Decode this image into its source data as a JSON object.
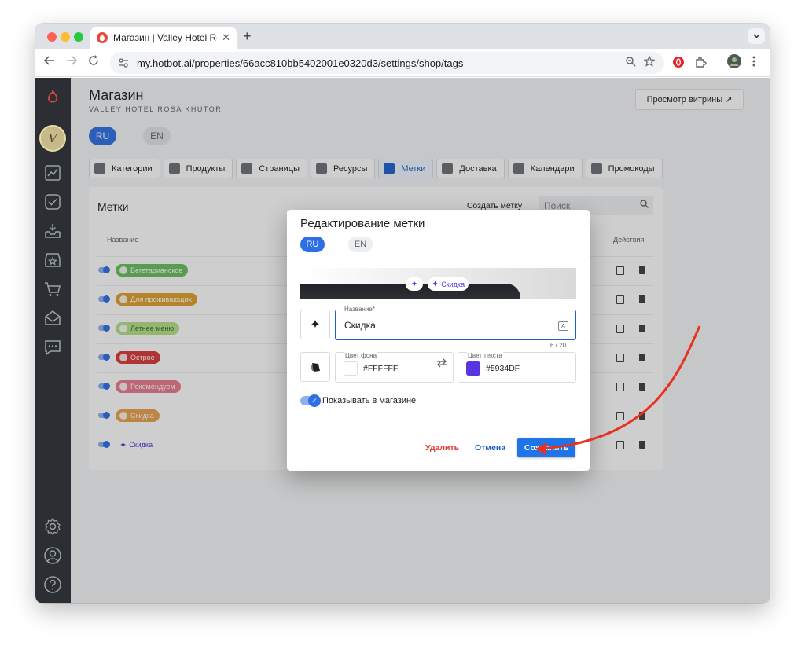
{
  "browser": {
    "tab_title": "Магазин | Valley Hotel Rosa K",
    "close_glyph": "✕",
    "new_tab_glyph": "+",
    "url": "my.hotbot.ai/properties/66acc810bb5402001e0320d3/settings/shop/tags"
  },
  "header": {
    "title": "Магазин",
    "subtitle": "VALLEY HOTEL ROSA KHUTOR",
    "preview_button": "Просмотр витрины ↗",
    "lang_ru": "RU",
    "lang_en": "EN"
  },
  "nav_tabs": [
    {
      "label": "Категории",
      "active": false
    },
    {
      "label": "Продукты",
      "active": false
    },
    {
      "label": "Страницы",
      "active": false
    },
    {
      "label": "Ресурсы",
      "active": false
    },
    {
      "label": "Метки",
      "active": true
    },
    {
      "label": "Доставка",
      "active": false
    },
    {
      "label": "Календари",
      "active": false
    },
    {
      "label": "Промокоды",
      "active": false
    }
  ],
  "card": {
    "title": "Метки",
    "create_button": "Создать метку",
    "search_placeholder": "Поиск",
    "col_name": "Название",
    "col_actions": "Действия"
  },
  "tags": [
    {
      "label": "Вегетарианское",
      "bg": "#6abf5e",
      "color": "#ffffff"
    },
    {
      "label": "Для проживающих",
      "bg": "#e0a02a",
      "color": "#ffffff"
    },
    {
      "label": "Летнее меню",
      "bg": "#b7e08a",
      "color": "#3a6b1e"
    },
    {
      "label": "Острое",
      "bg": "#d93a36",
      "color": "#ffffff"
    },
    {
      "label": "Рекомендуем",
      "bg": "#ea7a8c",
      "color": "#ffffff"
    },
    {
      "label": "Скидка",
      "bg": "#e8a24a",
      "color": "#ffffff"
    },
    {
      "label": "Скидка",
      "bg": "#ffffff",
      "color": "#5934df"
    }
  ],
  "modal": {
    "title": "Редактирование метки",
    "lang_ru": "RU",
    "lang_en": "EN",
    "preview_label": "Скидка",
    "name_label": "Название*",
    "name_value": "Скидка",
    "counter": "6 / 20",
    "bg_label": "Цвет фона",
    "bg_value": "#FFFFFF",
    "text_label": "Цвет текста",
    "text_value": "#5934DF",
    "show_label": "Показывать в магазине",
    "delete_button": "Удалить",
    "cancel_button": "Отмена",
    "save_button": "Сохранить",
    "accent": "#5934df"
  }
}
